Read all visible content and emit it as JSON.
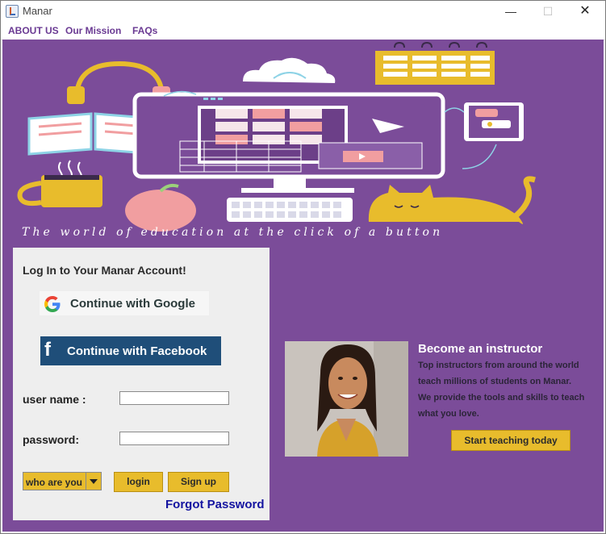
{
  "window": {
    "title": "Manar",
    "minimize_glyph": "—",
    "maximize_glyph": "☐",
    "close_glyph": "✕"
  },
  "menu": {
    "items": [
      "ABOUT US",
      "Our Mission",
      "FAQs"
    ]
  },
  "hero": {
    "tagline": "The world of  education at the click of a button"
  },
  "login": {
    "title": "Log In to Your  Manar Account!",
    "google_label": "Continue with Google",
    "facebook_label": "Continue with Facebook",
    "username_label": "user name :",
    "password_label": "password:",
    "username_value": "",
    "password_value": "",
    "role_select": "who are you",
    "login_button": "login",
    "signup_button": "Sign up",
    "forgot_password": "Forgot Password"
  },
  "instructor": {
    "title": "Become an instructor",
    "lines": [
      "Top instructors from around the world",
      " teach millions of students on Manar.",
      " We provide the tools and skills to teach",
      " what you love."
    ],
    "button": "Start teaching today"
  },
  "colors": {
    "background": "#7b4c99",
    "accent": "#e8bc2c",
    "facebook": "#1f4e79",
    "link": "#1414a0",
    "panel": "#eeeeee"
  },
  "icons": [
    "java-app-icon",
    "google-icon",
    "facebook-icon",
    "dropdown-arrow-icon"
  ]
}
